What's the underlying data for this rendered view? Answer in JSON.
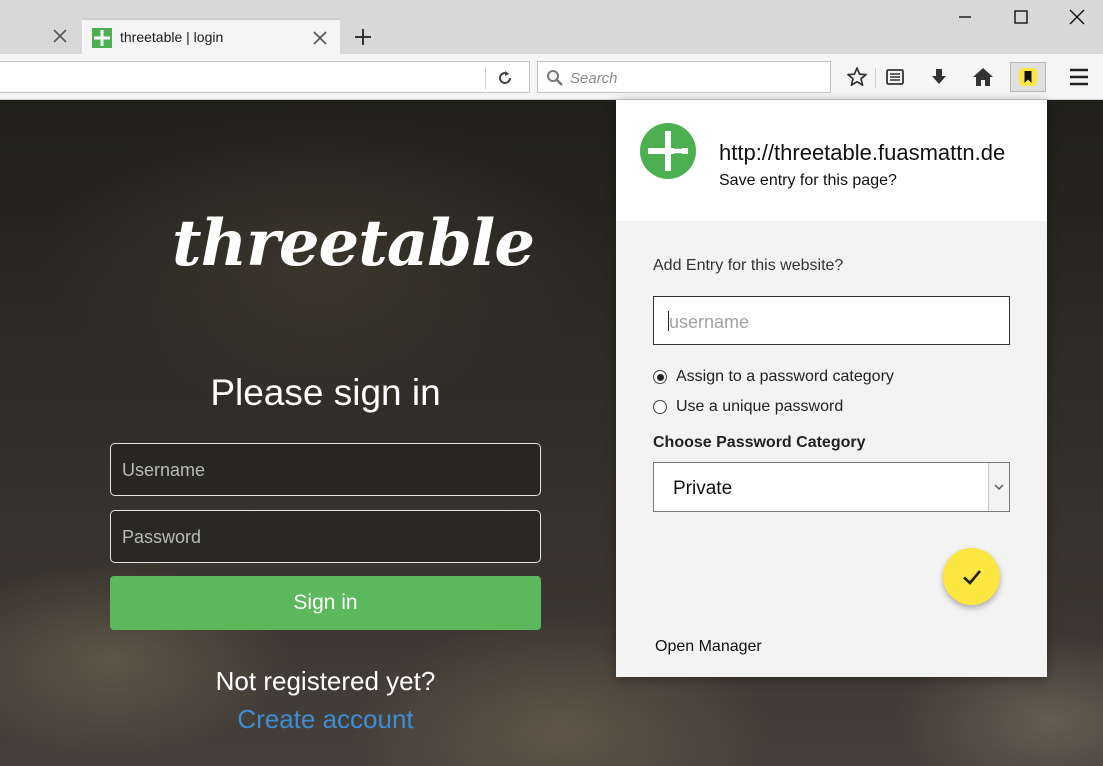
{
  "browser": {
    "active_tab_title": "threetable | login",
    "search_placeholder": "Search"
  },
  "page": {
    "logo_text": "threetable",
    "heading": "Please sign in",
    "username_placeholder": "Username",
    "password_placeholder": "Password",
    "signin_label": "Sign in",
    "not_registered": "Not registered yet?",
    "create_account": "Create account"
  },
  "popup": {
    "url": "http://threetable.fuasmattn.de",
    "subtitle": "Save entry for this page?",
    "add_label": "Add Entry for this website?",
    "username_placeholder": "username",
    "radio_options": [
      "Assign to a password category",
      "Use a unique password"
    ],
    "selected_radio": "Assign to a password category",
    "category_label": "Choose Password Category",
    "category_value": "Private",
    "open_manager": "Open Manager"
  },
  "colors": {
    "brand_green": "#4caf50",
    "signin_green": "#5cb85c",
    "link_blue": "#3d8ed6",
    "fab_yellow": "#fbe73f"
  },
  "icons": [
    "close-icon",
    "plus-icon",
    "minimize-icon",
    "maximize-icon",
    "reload-icon",
    "search-icon",
    "star-icon",
    "reading-list-icon",
    "download-icon",
    "home-icon",
    "bookmark-extension-icon",
    "hamburger-menu-icon",
    "check-icon",
    "chevron-down-icon"
  ]
}
